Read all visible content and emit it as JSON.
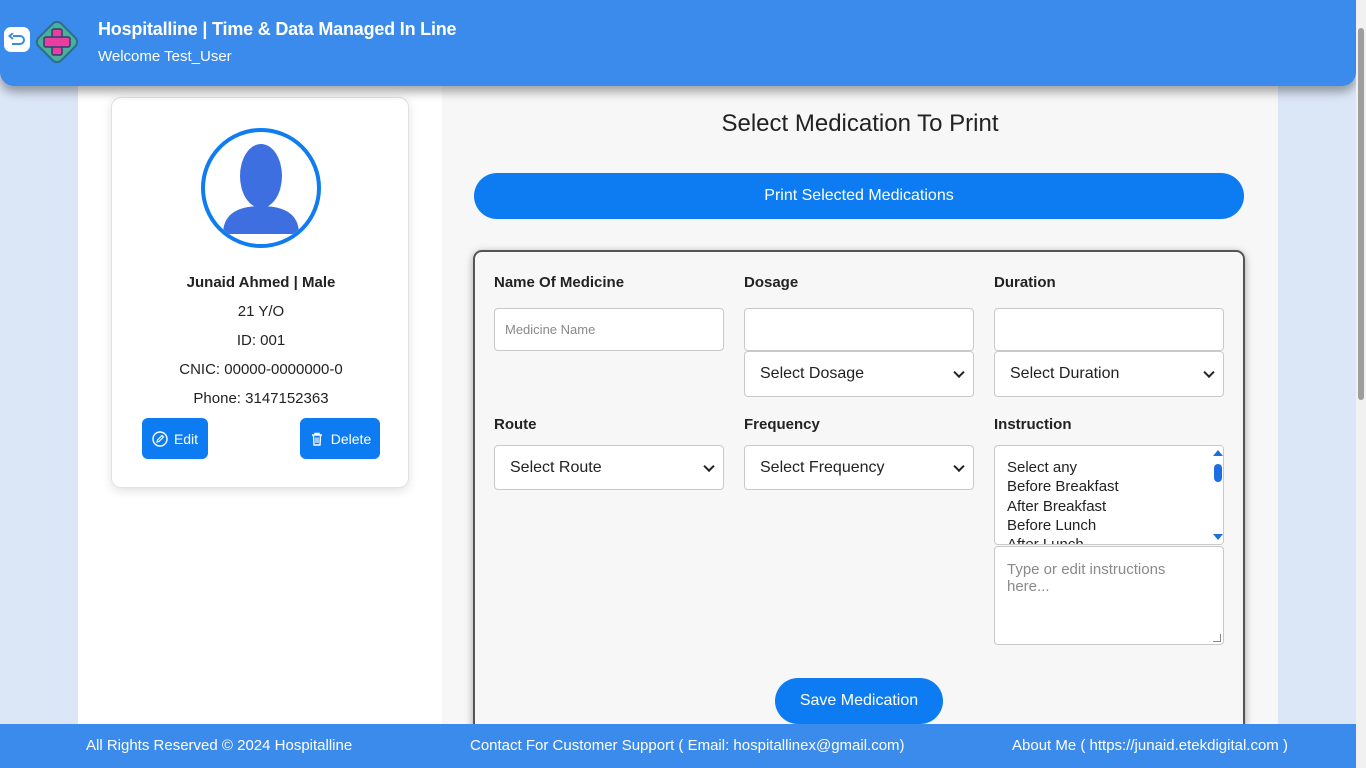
{
  "header": {
    "title": "Hospitalline | Time & Data Managed In Line",
    "welcome": "Welcome Test_User"
  },
  "patient": {
    "name_gender": "Junaid Ahmed | Male",
    "age": "21 Y/O",
    "id": "ID: 001",
    "cnic": "CNIC: 00000-0000000-0",
    "phone": "Phone: 3147152363",
    "edit_label": "Edit",
    "delete_label": "Delete"
  },
  "main": {
    "title": "Select Medication To Print",
    "print_label": "Print Selected Medications",
    "form": {
      "medicine_label": "Name Of Medicine",
      "medicine_placeholder": "Medicine Name",
      "dosage_label": "Dosage",
      "dosage_select": "Select Dosage",
      "duration_label": "Duration",
      "duration_select": "Select Duration",
      "route_label": "Route",
      "route_select": "Select Route",
      "frequency_label": "Frequency",
      "frequency_select": "Select Frequency",
      "instruction_label": "Instruction",
      "instruction_options": [
        "Select any",
        "Before Breakfast",
        "After Breakfast",
        "Before Lunch",
        "After Lunch"
      ],
      "instruction_placeholder": "Type or edit instructions here...",
      "save_label": "Save Medication"
    }
  },
  "footer": {
    "rights": "All Rights Reserved © 2024 Hospitalline",
    "contact": "Contact For Customer Support ( Email: hospitallinex@gmail.com)",
    "about": "About Me ( https://junaid.etekdigital.com )"
  },
  "colors": {
    "header_bg": "#3b8bec",
    "primary_button": "#0d7cf2",
    "avatar": "#3d6fe0"
  }
}
